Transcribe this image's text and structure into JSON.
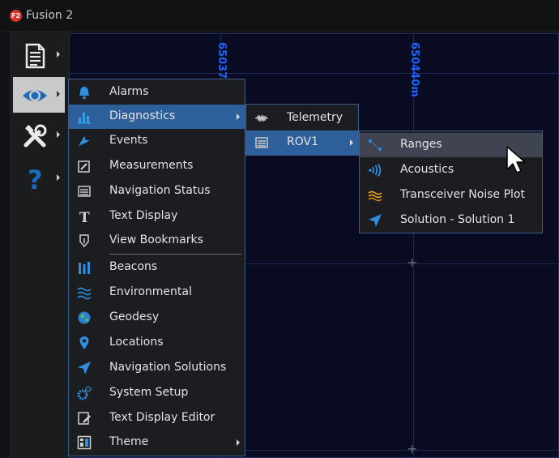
{
  "window": {
    "logo": "F2",
    "title": "Fusion 2"
  },
  "toolbar": {
    "buttons": [
      {
        "icon": "document-icon"
      },
      {
        "icon": "eye-icon",
        "active": true
      },
      {
        "icon": "tools-icon"
      },
      {
        "icon": "help-icon"
      }
    ]
  },
  "map": {
    "labels": [
      "65037",
      "650440m"
    ]
  },
  "main_menu": {
    "items": [
      {
        "label": "Alarms",
        "icon": "bell-icon"
      },
      {
        "label": "Diagnostics",
        "icon": "bar-chart-icon",
        "highlighted": true,
        "submenu": true
      },
      {
        "label": "Events",
        "icon": "flag-icon"
      },
      {
        "label": "Measurements",
        "icon": "edit-icon"
      },
      {
        "label": "Navigation Status",
        "icon": "panel-icon"
      },
      {
        "label": "Text Display",
        "icon": "text-icon"
      },
      {
        "label": "View Bookmarks",
        "icon": "bookmark-icon"
      },
      {
        "label": "Beacons",
        "icon": "beacons-icon"
      },
      {
        "label": "Environmental",
        "icon": "waves-icon"
      },
      {
        "label": "Geodesy",
        "icon": "globe-icon"
      },
      {
        "label": "Locations",
        "icon": "pin-icon"
      },
      {
        "label": "Navigation Solutions",
        "icon": "nav-arrow-icon"
      },
      {
        "label": "System Setup",
        "icon": "gears-icon"
      },
      {
        "label": "Text Display Editor",
        "icon": "pencil-icon"
      },
      {
        "label": "Theme",
        "icon": "theme-icon",
        "submenu": true
      }
    ]
  },
  "diagnostics_menu": {
    "items": [
      {
        "label": "Telemetry",
        "icon": "signal-icon"
      },
      {
        "label": "ROV1",
        "icon": "panel-icon",
        "highlighted": true,
        "submenu": true
      }
    ]
  },
  "rov_menu": {
    "items": [
      {
        "label": "Ranges",
        "icon": "ranges-icon",
        "hover": true
      },
      {
        "label": "Acoustics",
        "icon": "acoustics-icon"
      },
      {
        "label": "Transceiver Noise Plot",
        "icon": "noise-icon"
      },
      {
        "label": "Solution - Solution 1",
        "icon": "nav-arrow-icon"
      }
    ]
  }
}
